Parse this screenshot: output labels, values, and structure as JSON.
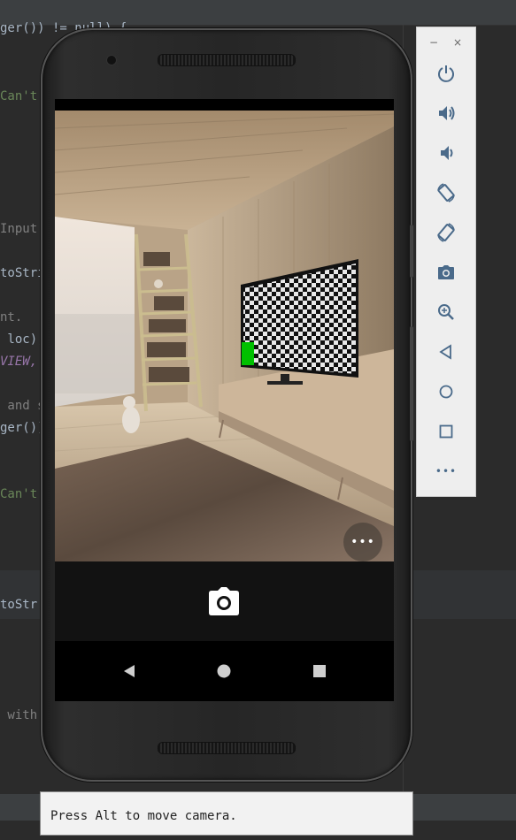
{
  "ide": {
    "code_fragments": [
      "ger()) != null) {",
      "Can't",
      "Input",
      "toStri",
      "nt.",
      " loc);",
      "VIEW,",
      " and s",
      "ger())",
      "Can't",
      "toStr",
      " with:"
    ]
  },
  "emulator": {
    "camera_app": {
      "more_button_label": "•••",
      "more_button_icon": "more-horizontal-icon",
      "shutter_icon": "camera-icon"
    },
    "nav_bar": {
      "back_icon": "back-triangle-icon",
      "home_icon": "home-circle-icon",
      "recents_icon": "recents-square-icon"
    },
    "toolbar": {
      "minimize_label": "−",
      "close_label": "×",
      "buttons": [
        {
          "name": "power",
          "icon": "power-icon"
        },
        {
          "name": "volume-up",
          "icon": "volume-up-icon"
        },
        {
          "name": "volume-down",
          "icon": "volume-down-icon"
        },
        {
          "name": "rotate-left",
          "icon": "rotate-left-icon"
        },
        {
          "name": "rotate-right",
          "icon": "rotate-right-icon"
        },
        {
          "name": "screenshot",
          "icon": "camera-icon"
        },
        {
          "name": "zoom",
          "icon": "zoom-in-icon"
        },
        {
          "name": "back",
          "icon": "back-icon"
        },
        {
          "name": "home",
          "icon": "home-icon"
        },
        {
          "name": "overview",
          "icon": "overview-icon"
        },
        {
          "name": "more",
          "icon": "more-icon"
        }
      ],
      "more_label": "•••"
    },
    "tooltip": {
      "text": "Press Alt to move camera."
    }
  },
  "colors": {
    "ide_background": "#2b2b2b",
    "toolbar_icon": "#4a6a8a",
    "tv_green_square": "#00c000"
  }
}
